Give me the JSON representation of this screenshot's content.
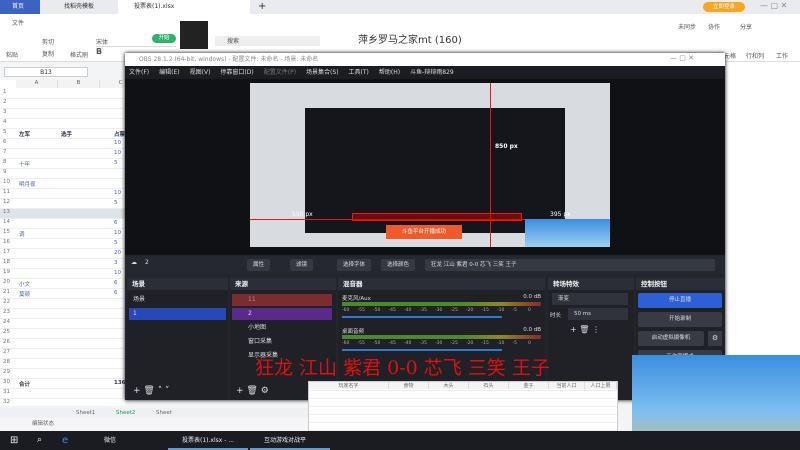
{
  "wps": {
    "tabs": [
      "首页",
      "找稻壳模板",
      "投票表(1).xlsx"
    ],
    "login": "立即登录",
    "menu": {
      "file": "文件",
      "start": "开始",
      "paste": "粘贴",
      "cut": "剪切",
      "copy": "复制",
      "format_painter": "格式刷",
      "font": "宋体",
      "font_size": "10",
      "search": "搜索",
      "sync": "未同步",
      "collab": "协作",
      "share": "分享",
      "fill": "填充",
      "cell": "单元格",
      "rowcol": "行和列",
      "sheet": "工作"
    },
    "doc_title": "萍乡罗马之家mt (160)",
    "name_box": "B13",
    "columns": [
      "A",
      "B",
      "C"
    ],
    "rows": [
      "1",
      "2",
      "3",
      "4",
      "5",
      "6",
      "7",
      "8",
      "9",
      "10",
      "11",
      "12",
      "13",
      "14",
      "15",
      "16",
      "17",
      "18",
      "19",
      "20",
      "21",
      "22",
      "23",
      "24",
      "25",
      "26",
      "27",
      "28",
      "29",
      "30",
      "31",
      "32"
    ],
    "cells": [
      {
        "r": 5,
        "a": "左军",
        "b": "选手",
        "c": "占票"
      },
      {
        "r": 6,
        "c": "10"
      },
      {
        "r": 7,
        "c": "10"
      },
      {
        "r": 8,
        "a": "十年",
        "c": "5"
      },
      {
        "r": 10,
        "a": "明月夜"
      },
      {
        "r": 11,
        "c": "10"
      },
      {
        "r": 12,
        "c": "5"
      },
      {
        "r": 14,
        "c": "6"
      },
      {
        "r": 15,
        "a": "调",
        "c": "10"
      },
      {
        "r": 16,
        "c": "5"
      },
      {
        "r": 17,
        "c": "20"
      },
      {
        "r": 18,
        "c": "3"
      },
      {
        "r": 19,
        "c": "10"
      },
      {
        "r": 20,
        "a": "小文",
        "c": "6"
      },
      {
        "r": 21,
        "a": "莫顿",
        "c": "6"
      },
      {
        "r": 30,
        "a": "合计",
        "c": "136"
      }
    ],
    "sheets": [
      "Sheet1",
      "Sheet2",
      "Sheet"
    ],
    "status": "编辑状态"
  },
  "obs": {
    "title": "OBS 28.1.2 (64-bit, windows) - 配置文件: 未命名 - 场景: 未命名",
    "menu": [
      "文件(F)",
      "编辑(E)",
      "视图(V)",
      "停靠窗口(D)",
      "配置文件(P)",
      "场景集合(S)",
      "工具(T)",
      "帮助(H)",
      "斗鱼-辩辩雨829"
    ],
    "preview": {
      "px_left": "550 px",
      "px_right": "395 px",
      "px_top": "850 px",
      "toast": "斗鱼平台开播成功"
    },
    "source_name": "2",
    "toolbar": [
      "属性",
      "滤镜",
      "选择字体",
      "选择颜色",
      "狂龙 江山 紫君 0-0 芯飞 三笑 王子"
    ],
    "scenes": {
      "title": "场景",
      "items": [
        "场景",
        "1"
      ]
    },
    "sources": {
      "title": "来源",
      "items": [
        "11",
        "2",
        "小地图",
        "窗口采集",
        "显示器采集"
      ]
    },
    "mixer": {
      "title": "混音器",
      "channels": [
        {
          "name": "麦克风/Aux",
          "db": "0.0 dB"
        },
        {
          "name": "桌面音频",
          "db": "0.0 dB"
        }
      ],
      "ticks": [
        "-60",
        "-55",
        "-50",
        "-45",
        "-40",
        "-35",
        "-30",
        "-25",
        "-20",
        "-15",
        "-10",
        "-5",
        "0"
      ]
    },
    "transitions": {
      "title": "转场特效",
      "type": "渐变",
      "duration_label": "时长",
      "duration": "50 ms"
    },
    "controls": {
      "title": "控制按钮",
      "stop_stream": "停止直播",
      "start_record": "开始录制",
      "virtual_cam": "启动虚拟摄像机",
      "studio": "工作室模式"
    }
  },
  "overlay_text": "狂龙 江山 紫君 0-0 芯飞 三笑 王子",
  "table": {
    "headers": [
      "玩家名字",
      "食物",
      "木头",
      "石头",
      "金子",
      "当前人口",
      "人口上限"
    ]
  },
  "taskbar": {
    "wechat": "微信",
    "wps": "投票表(1).xlsx - ...",
    "game": "互动游戏对战平"
  },
  "colors": {
    "accent": "#2d5fd6",
    "overlay": "#e01010",
    "wps_blue": "#3e62c4"
  }
}
